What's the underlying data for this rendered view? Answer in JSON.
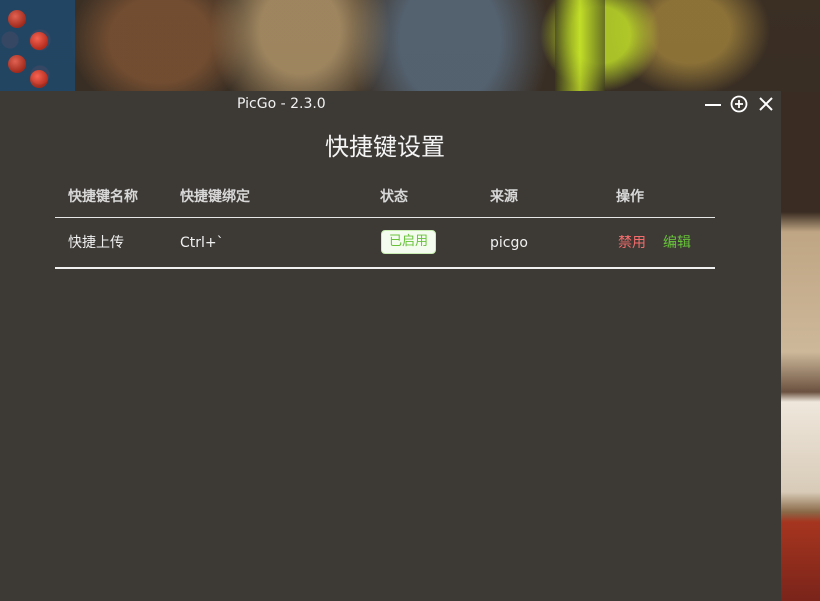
{
  "window": {
    "title": "PicGo - 2.3.0",
    "controls": [
      "minimize-icon",
      "zoom-plus-icon",
      "close-icon"
    ]
  },
  "page": {
    "title": "快捷键设置"
  },
  "table": {
    "headers": [
      "快捷键名称",
      "快捷键绑定",
      "状态",
      "来源",
      "操作"
    ],
    "rows": [
      {
        "name": "快捷上传",
        "binding": "Ctrl+`",
        "status": "已启用",
        "source": "picgo",
        "actions": {
          "disable": "禁用",
          "edit": "编辑"
        }
      }
    ]
  },
  "colors": {
    "window_bg": "#3d3a36",
    "success": "#67c23a",
    "danger": "#f56c6c"
  }
}
